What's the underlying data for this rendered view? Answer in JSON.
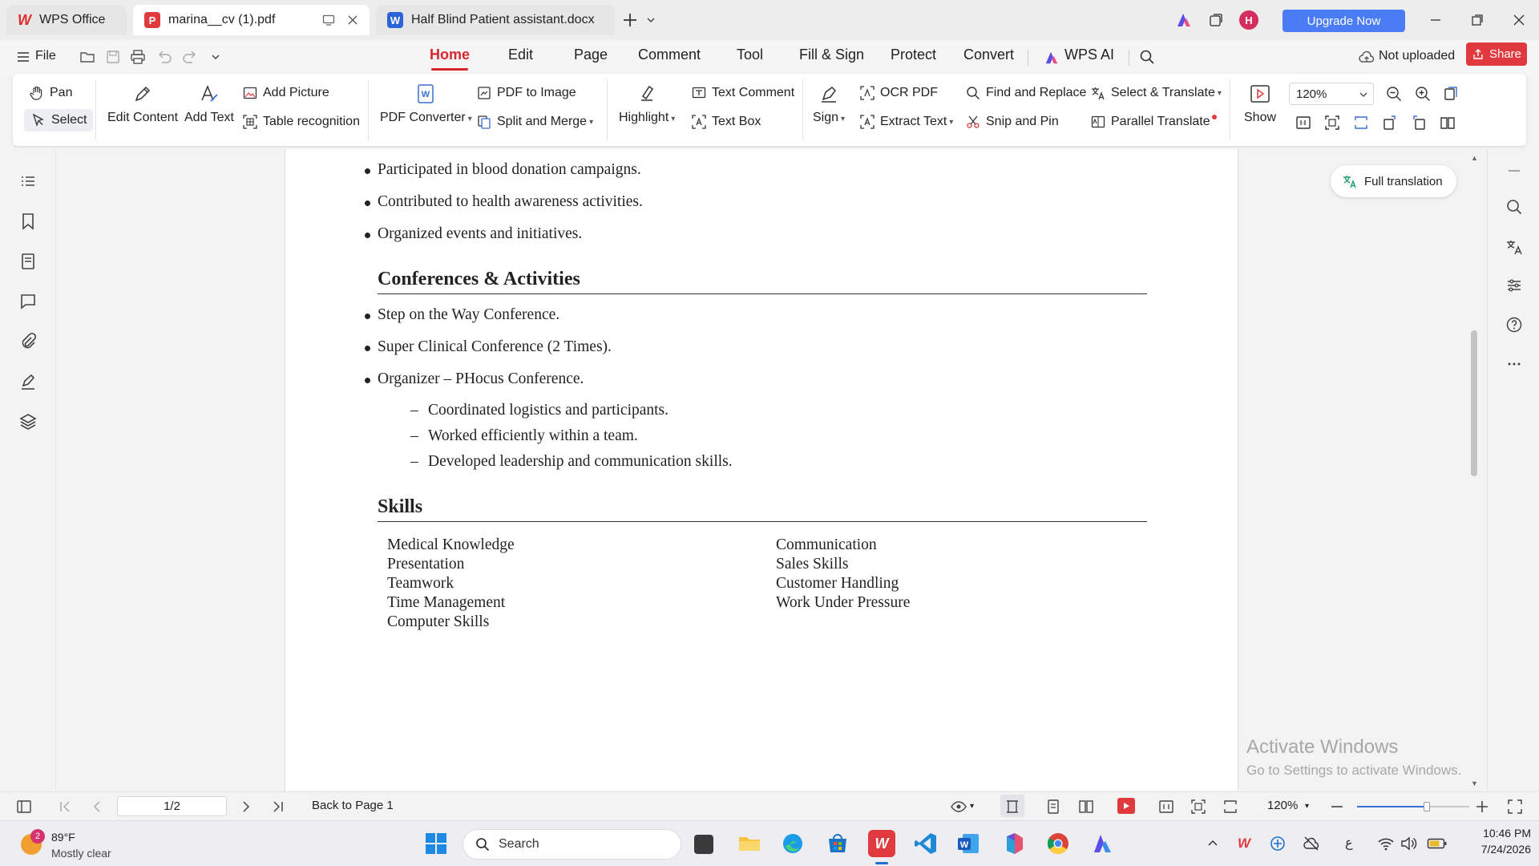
{
  "tabs": [
    {
      "label": "WPS Office"
    },
    {
      "label": "marina__cv (1).pdf"
    },
    {
      "label": "Half Blind Patient assistant.docx"
    }
  ],
  "titlebar": {
    "avatar_initial": "H",
    "upgrade_label": "Upgrade Now"
  },
  "menu": {
    "file_label": "File",
    "tabs": [
      "Home",
      "Edit",
      "Page",
      "Comment",
      "Tool",
      "Fill & Sign",
      "Protect",
      "Convert",
      "WPS AI"
    ],
    "active_tab": "Home",
    "not_uploaded": "Not uploaded",
    "share": "Share"
  },
  "ribbon": {
    "pan": "Pan",
    "select": "Select",
    "edit_content": "Edit Content",
    "add_text": "Add Text",
    "add_picture": "Add Picture",
    "table_recognition": "Table recognition",
    "pdf_converter": "PDF Converter",
    "pdf_to_image": "PDF to Image",
    "split_merge": "Split and Merge",
    "highlight": "Highlight",
    "text_comment": "Text Comment",
    "text_box": "Text Box",
    "sign": "Sign",
    "ocr_pdf": "OCR PDF",
    "extract_text": "Extract Text",
    "find_replace": "Find and Replace",
    "snip_pin": "Snip and Pin",
    "select_translate": "Select & Translate",
    "parallel_translate": "Parallel Translate",
    "show": "Show",
    "zoom_value": "120%"
  },
  "document": {
    "top_bullets": [
      "Participated in blood donation campaigns.",
      "Contributed to health awareness activities.",
      "Organized events and initiatives."
    ],
    "conferences_title": "Conferences & Activities",
    "conference_bullets": [
      "Step on the Way Conference.",
      "Super Clinical Conference (2 Times).",
      "Organizer – PHocus Conference."
    ],
    "organizer_subitems": [
      "Coordinated logistics and participants.",
      "Worked efficiently within a team.",
      "Developed leadership and communication skills."
    ],
    "skills_title": "Skills",
    "skills_left": [
      "Medical Knowledge",
      "Presentation",
      "Teamwork",
      "Time Management",
      "Computer Skills"
    ],
    "skills_right": [
      "Communication",
      "Sales Skills",
      "Customer Handling",
      "Work Under Pressure"
    ]
  },
  "side_panel": {
    "full_translation": "Full translation",
    "activate_title": "Activate Windows",
    "activate_sub": "Go to Settings to activate Windows."
  },
  "statusbar": {
    "page_indicator": "1/2",
    "back_to_page": "Back to Page 1",
    "zoom": "120%",
    "zoom_slider_fraction": 0.62
  },
  "taskbar": {
    "weather_badge": "2",
    "temperature": "89°F",
    "weather_desc": "Mostly clear",
    "search_label": "Search",
    "time": "10:46 PM",
    "date": "7/24/2026",
    "lang_indicator": "ع"
  },
  "colors": {
    "accent_red": "#d8262c",
    "upgrade_blue": "#4a7cf5",
    "share_red": "#e0393e"
  }
}
